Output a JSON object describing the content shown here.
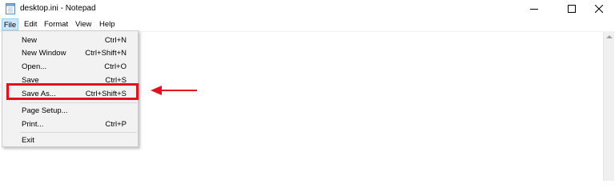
{
  "window": {
    "title": "desktop.ini - Notepad",
    "controls": [
      "minimize",
      "maximize",
      "close"
    ]
  },
  "menubar": {
    "items": [
      {
        "label": "File",
        "active": true
      },
      {
        "label": "Edit"
      },
      {
        "label": "Format"
      },
      {
        "label": "View"
      },
      {
        "label": "Help"
      }
    ]
  },
  "file_menu": {
    "items": [
      {
        "label": "New",
        "shortcut": "Ctrl+N"
      },
      {
        "label": "New Window",
        "shortcut": "Ctrl+Shift+N"
      },
      {
        "label": "Open...",
        "shortcut": "Ctrl+O"
      },
      {
        "label": "Save",
        "shortcut": "Ctrl+S"
      },
      {
        "label": "Save As...",
        "shortcut": "Ctrl+Shift+S",
        "highlighted": true
      },
      {
        "label": "Page Setup...",
        "shortcut": ""
      },
      {
        "label": "Print...",
        "shortcut": "Ctrl+P"
      },
      {
        "label": "Exit",
        "shortcut": ""
      }
    ]
  },
  "annotation": {
    "highlight_color": "#e4101b",
    "target": "Save As..."
  },
  "colors": {
    "menu_active_bg": "#cce8ff",
    "dropdown_bg": "#f2f2f2"
  }
}
